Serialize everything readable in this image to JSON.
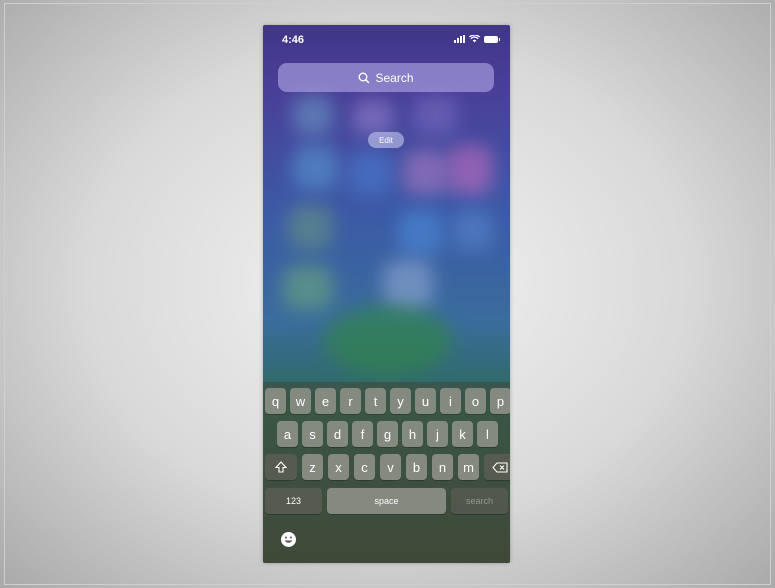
{
  "status": {
    "time": "4:46"
  },
  "search": {
    "placeholder": "Search"
  },
  "edit_label": "Edit",
  "keyboard": {
    "row1": [
      "q",
      "w",
      "e",
      "r",
      "t",
      "y",
      "u",
      "i",
      "o",
      "p"
    ],
    "row2": [
      "a",
      "s",
      "d",
      "f",
      "g",
      "h",
      "j",
      "k",
      "l"
    ],
    "row3": [
      "z",
      "x",
      "c",
      "v",
      "b",
      "n",
      "m"
    ],
    "numbers_label": "123",
    "space_label": "space",
    "search_label": "search"
  },
  "icons": [
    "signal-icon",
    "wifi-icon",
    "battery-icon",
    "search-icon",
    "shift-icon",
    "delete-icon",
    "emoji-icon"
  ]
}
